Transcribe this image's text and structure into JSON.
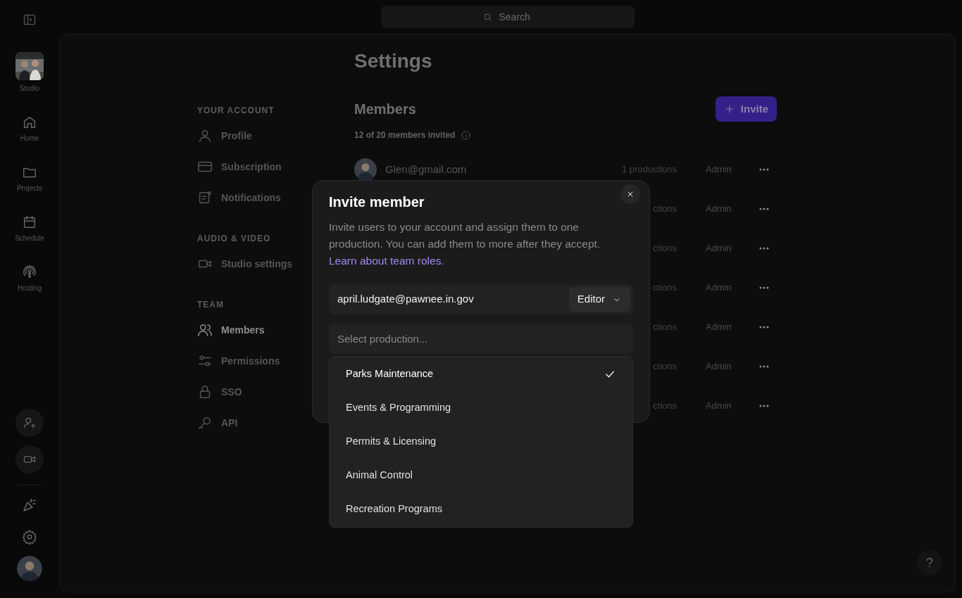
{
  "rail": {
    "items": [
      {
        "label": "Studio"
      },
      {
        "label": "Home"
      },
      {
        "label": "Projects"
      },
      {
        "label": "Schedule"
      },
      {
        "label": "Hosting"
      }
    ]
  },
  "search": {
    "placeholder": "Search"
  },
  "settings": {
    "title": "Settings",
    "nav": [
      {
        "heading": "YOUR ACCOUNT",
        "items": [
          {
            "label": "Profile",
            "selected": false
          },
          {
            "label": "Subscription",
            "selected": false
          },
          {
            "label": "Notifications",
            "selected": false
          }
        ]
      },
      {
        "heading": "AUDIO & VIDEO",
        "items": [
          {
            "label": "Studio settings",
            "selected": false
          }
        ]
      },
      {
        "heading": "TEAM",
        "items": [
          {
            "label": "Members",
            "selected": true
          },
          {
            "label": "Permissions",
            "selected": false
          },
          {
            "label": "SSO",
            "selected": false
          },
          {
            "label": "API",
            "selected": false
          }
        ]
      }
    ]
  },
  "members": {
    "title": "Members",
    "invite_button": "Invite",
    "count": "12 of 20 members invited",
    "rows": [
      {
        "email": "Glen@gmail.com",
        "productions": "1 productions",
        "role": "Admin"
      },
      {
        "productions": "ctions",
        "role": "Admin"
      },
      {
        "productions": "ctions",
        "role": "Admin"
      },
      {
        "productions": "ctions",
        "role": "Admin"
      },
      {
        "productions": "ctions",
        "role": "Admin"
      },
      {
        "productions": "ctions",
        "role": "Admin"
      },
      {
        "productions": "ctions",
        "role": "Admin"
      }
    ]
  },
  "modal": {
    "title": "Invite member",
    "description": "Invite users to your account and assign them to one production. You can add them to more after they accept.",
    "link": "Learn about team roles.",
    "email": "april.ludgate@pawnee.in.gov",
    "role": "Editor",
    "production": {
      "placeholder": "Select production..."
    },
    "options": [
      {
        "label": "Parks Maintenance",
        "selected": true
      },
      {
        "label": "Events & Programming",
        "selected": false
      },
      {
        "label": "Permits & Licensing",
        "selected": false
      },
      {
        "label": "Animal Control",
        "selected": false
      },
      {
        "label": "Recreation Programs",
        "selected": false
      }
    ]
  },
  "help": "?"
}
